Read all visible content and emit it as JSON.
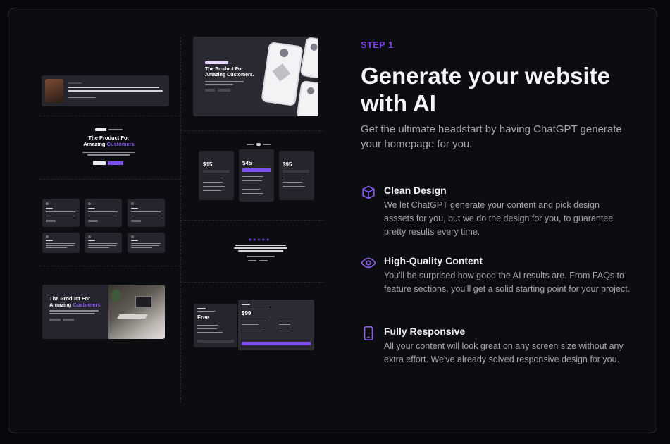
{
  "section": {
    "step_label": "STEP 1",
    "headline": "Generate your website with AI",
    "subheadline": "Get the ultimate headstart by having ChatGPT generate your homepage for you."
  },
  "features": [
    {
      "icon": "cube-icon",
      "title": "Clean Design",
      "description": "We let ChatGPT generate your content and pick design asssets for you, but we do the design for you, to guarantee pretty results every time."
    },
    {
      "icon": "eye-icon",
      "title": "High-Quality Content",
      "description": "You'll be surprised how good the AI results are. From FAQs to feature sections, you'll get a solid starting point for your project."
    },
    {
      "icon": "phone-icon",
      "title": "Fully Responsive",
      "description": "All your content will look great on any screen size without any extra effort. We've already solved responsive design for you."
    }
  ],
  "previews": {
    "hero_mockup_title_line1": "The Product For",
    "hero_mockup_title_line2": "Amazing Customers.",
    "center_hero_line1": "The Product For",
    "center_hero_line2_prefix": "Amazing ",
    "center_hero_line2_accent": "Customers",
    "image_hero_line1": "The Product For",
    "image_hero_line2_prefix": "Amazing ",
    "image_hero_line2_accent": "Customers",
    "pricing_prices": [
      "$15",
      "$45",
      "$95"
    ],
    "pricing2_prices": [
      "Free",
      "$99"
    ],
    "rating_stars": "★★★★★"
  },
  "colors": {
    "accent": "#7b3fe4",
    "background": "#0c0d11",
    "card_border": "#2a2c33",
    "text_primary": "#f4f4f6",
    "text_secondary": "#a6a7ad"
  }
}
